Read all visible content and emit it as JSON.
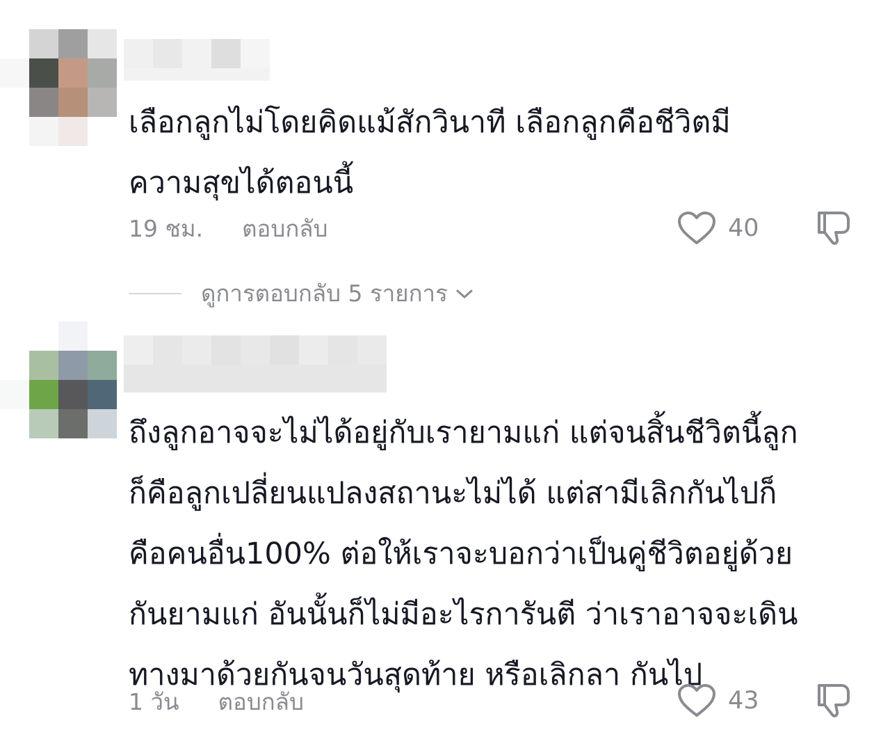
{
  "comments": [
    {
      "avatar_colors": [
        "#d4d4d4",
        "#9f9f9f",
        "#e6e6e6",
        "#4a4f4a",
        "#c49a87",
        "#a8aaa7",
        "#8a8686",
        "#b69079",
        "#b8b6b5",
        "#f4f4f4",
        "#f1e9e8",
        "#fbfbfb"
      ],
      "name_colors": [
        "#f0f0f0",
        "#e8e8e8",
        "#f2f2f2",
        "#dedede",
        "#f5f5f5"
      ],
      "text_lines": [
        "เลือกลูกไม่โดยคิดแม้สักวินาที เลือกลูกคือชีวิตมี",
        "ความสุขได้ตอนนี้"
      ],
      "time": "19 ชม.",
      "reply_label": "ตอบกลับ",
      "likes": "40",
      "view_replies": "ดูการตอบกลับ 5 รายการ"
    },
    {
      "avatar_colors": [
        "#f2f3f6",
        "#a9bfa2",
        "#8e9aa8",
        "#8eab9c",
        "#6ea548",
        "#58585a",
        "#4f6776",
        "#b8cbb8",
        "#6c6e6c",
        "#cdd4da"
      ],
      "name_colors": [
        "#eeeeee",
        "#e6e6e6",
        "#ebebeb",
        "#e3e3e3",
        "#e8e8e8",
        "#e1e1e1",
        "#ececec",
        "#e5e5e5",
        "#eaeaea"
      ],
      "text_lines": [
        "ถึงลูกอาจจะไม่ได้อยู่กับเรายามแก่ แต่จนสิ้นชีวิตนี้ลูก",
        "ก็คือลูกเปลี่ยนแปลงสถานะไม่ได้ แต่สามีเลิกกันไปก็",
        "คือคนอื่น100% ต่อให้เราจะบอกว่าเป็นคู่ชีวิตอยู่ด้วย",
        "กันยามแก่ อันนั้นก็ไม่มีอะไรการันตี ว่าเราอาจจะเดิน",
        "ทางมาด้วยกันจนวันสุดท้าย หรือเลิกลา กันไป"
      ],
      "time": "1 วัน",
      "reply_label": "ตอบกลับ",
      "likes": "43"
    }
  ]
}
